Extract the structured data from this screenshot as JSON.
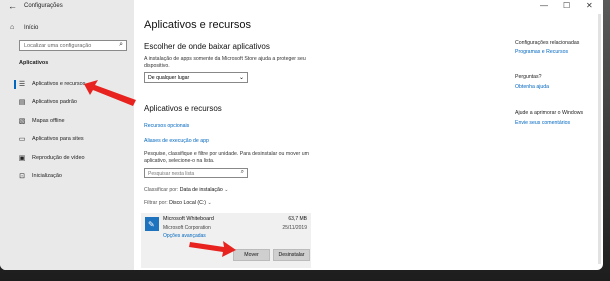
{
  "window": {
    "title": "Configurações",
    "back": "←",
    "minimize": "—",
    "maximize": "☐",
    "close": "✕"
  },
  "sidebar": {
    "home": "Início",
    "search_placeholder": "Localizar uma configuração",
    "section": "Aplicativos",
    "items": [
      {
        "label": "Aplicativos e recursos",
        "icon": "apps-list-icon"
      },
      {
        "label": "Aplicativos padrão",
        "icon": "default-apps-icon"
      },
      {
        "label": "Mapas offline",
        "icon": "offline-maps-icon"
      },
      {
        "label": "Aplicativos para sites",
        "icon": "apps-for-websites-icon"
      },
      {
        "label": "Reprodução de vídeo",
        "icon": "video-playback-icon"
      },
      {
        "label": "Inicialização",
        "icon": "startup-icon"
      }
    ]
  },
  "main": {
    "title": "Aplicativos e recursos",
    "install_heading": "Escolher de onde baixar aplicativos",
    "install_desc": "A instalação de apps somente da Microsoft Store ajuda a proteger seu dispositivo.",
    "install_value": "De qualquer lugar",
    "apps_heading": "Aplicativos e recursos",
    "optional_link": "Recursos opcionais",
    "alias_link": "Aliases de execução de app",
    "search_desc": "Pesquise, classifique e filtre por unidade. Para desinstalar ou mover um aplicativo, selecione-o na lista.",
    "list_search_placeholder": "Pesquisar nesta lista",
    "sort_label": "Classificar por:",
    "sort_value": "Data de instalação",
    "filter_label": "Filtrar por:",
    "filter_value": "Disco Local (C:)",
    "app": {
      "name": "Microsoft Whiteboard",
      "publisher": "Microsoft Corporation",
      "advanced": "Opções avançadas",
      "size": "63,7 MB",
      "date": "25/11/2019",
      "move": "Mover",
      "uninstall": "Desinstalar"
    }
  },
  "related": {
    "heading": "Configurações relacionadas",
    "programs_link": "Programas e Recursos",
    "questions_heading": "Perguntas?",
    "help_link": "Obtenha ajuda",
    "improve_heading": "Ajude a aprimorar o Windows",
    "feedback_link": "Envie seus comentários"
  },
  "colors": {
    "accent": "#0067c0",
    "annotation_arrow": "#e8231f"
  }
}
